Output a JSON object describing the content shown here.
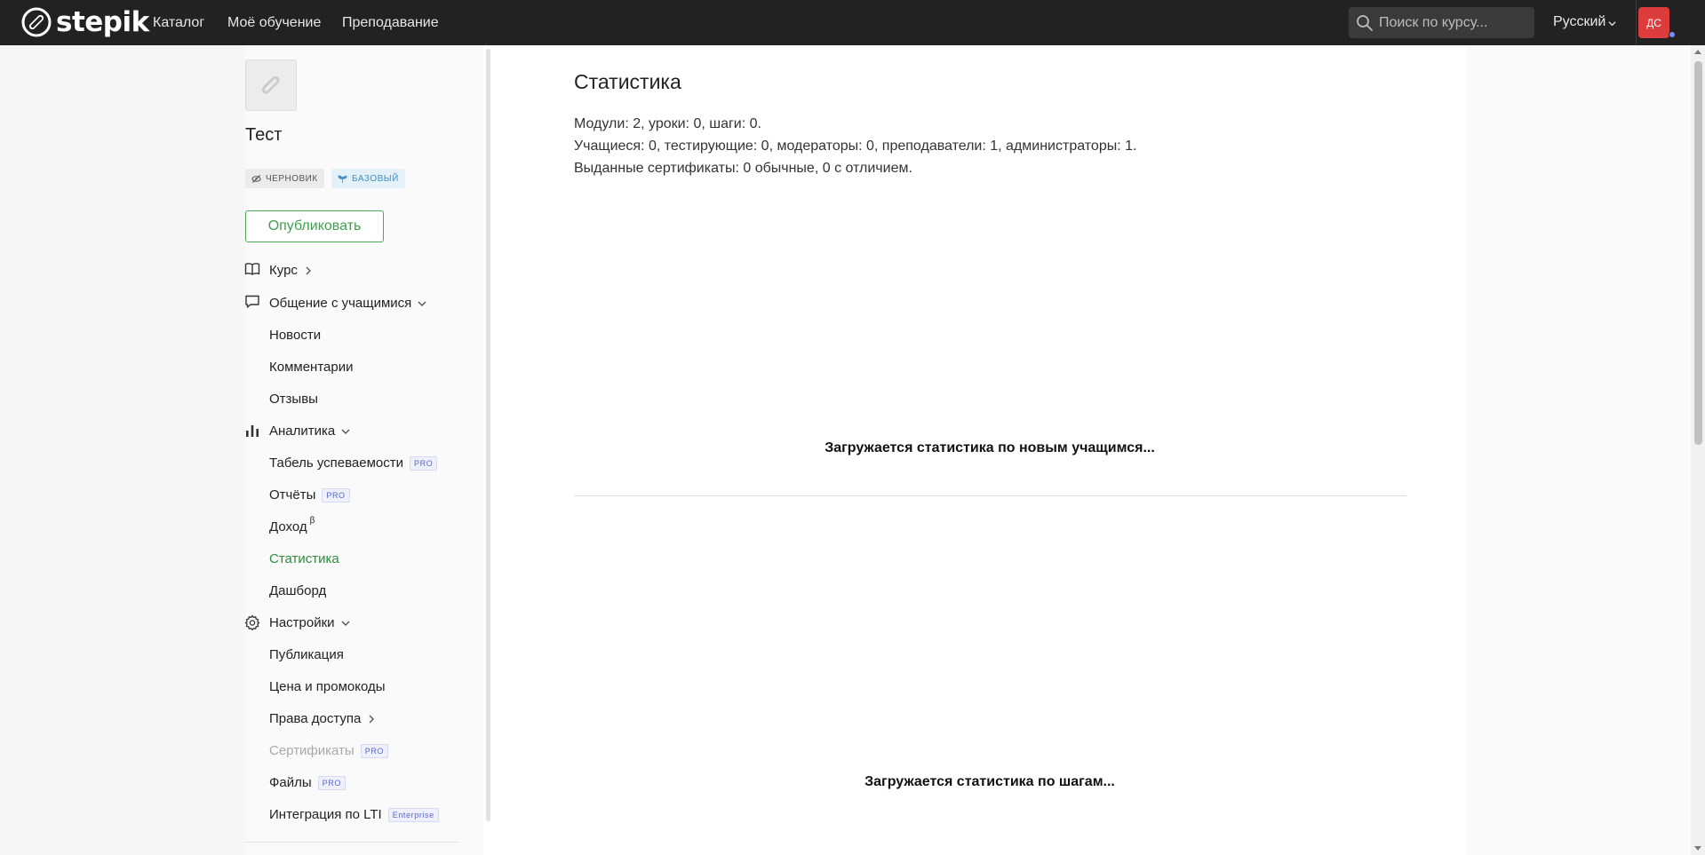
{
  "header": {
    "logo_text": "stepik",
    "nav": [
      "Каталог",
      "Моё обучение",
      "Преподавание"
    ],
    "search_placeholder": "Поиск по курсу...",
    "language": "Русский",
    "avatar_initials": "ДС"
  },
  "course": {
    "title": "Тест",
    "badge_draft": "ЧЕРНОВИК",
    "badge_basic": "БАЗОВЫЙ",
    "publish_label": "Опубликовать"
  },
  "sidebar": {
    "course": "Курс",
    "communication": "Общение с учащимися",
    "news": "Новости",
    "comments": "Комментарии",
    "reviews": "Отзывы",
    "analytics": "Аналитика",
    "gradebook": "Табель успеваемости",
    "reports": "Отчёты",
    "income": "Доход",
    "income_beta": "β",
    "statistics": "Статистика",
    "dashboard": "Дашборд",
    "settings": "Настройки",
    "publication": "Публикация",
    "pricing": "Цена и промокоды",
    "access": "Права доступа",
    "certificates": "Сертификаты",
    "files": "Файлы",
    "lti": "Интеграция по LTI",
    "pro_label": "PRO",
    "enterprise_label": "Enterprise"
  },
  "main": {
    "title": "Статистика",
    "summary_modules": "Модули: 2, уроки: 0, шаги: 0.",
    "summary_learners": "Учащиеся: 0, тестирующие: 0, модераторы: 0, преподаватели: 1, администраторы: 1.",
    "summary_certificates": "Выданные сертификаты: 0 обычные, 0 с отличием.",
    "loading_learners": "Загружается статистика по новым учащимся...",
    "loading_steps": "Загружается статистика по шагам..."
  },
  "colors": {
    "topbar": "#222222",
    "accent_green": "#2e8b3e",
    "avatar": "#dc3c3c",
    "pro_badge": "#5a67c9"
  }
}
